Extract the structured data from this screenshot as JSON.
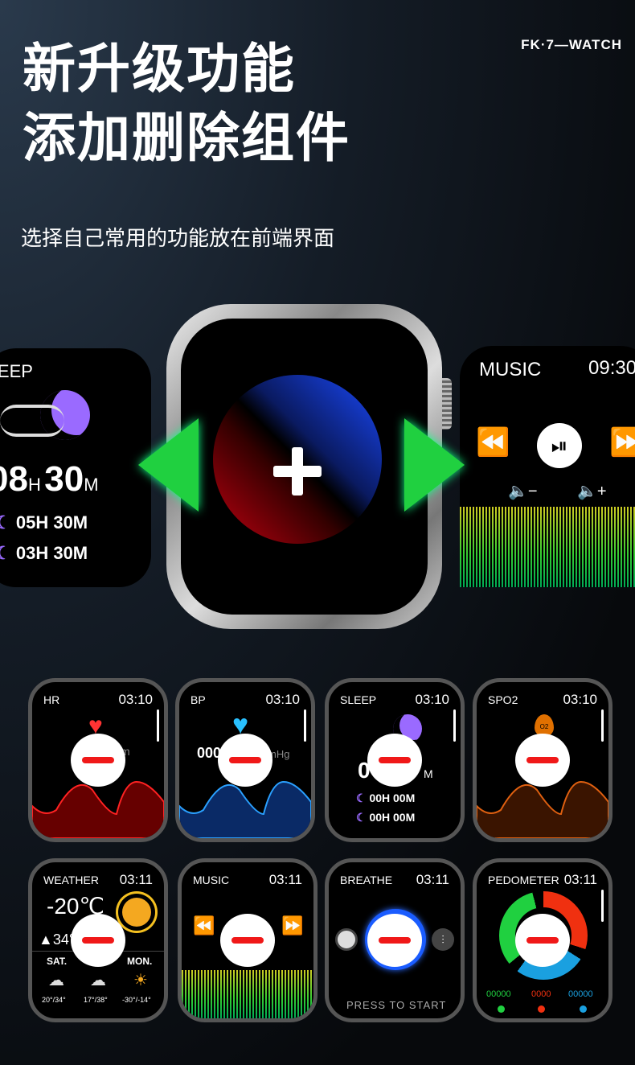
{
  "brand": "FK·7—WATCH",
  "headline": [
    "新升级功能",
    "添加删除组件"
  ],
  "subtitle": "选择自己常用的功能放在前端界面",
  "left_card": {
    "label": "SLEEP",
    "total_h": "08",
    "total_m": "30",
    "h_unit": "H",
    "m_unit": "M",
    "deep": "05H 30M",
    "light": "03H 30M"
  },
  "right_card": {
    "label": "MUSIC",
    "time": "09:30"
  },
  "colors": {
    "accent_green": "#20d040",
    "minus_red": "#f01818"
  },
  "tiles": [
    {
      "label": "HR",
      "time": "03:10",
      "unit": "m"
    },
    {
      "label": "BP",
      "time": "03:10",
      "value": "000",
      "unit": "mHg"
    },
    {
      "label": "SLEEP",
      "time": "03:10",
      "value": "0",
      "unit": "M",
      "deep": "00H 00M",
      "light": "00H 00M"
    },
    {
      "label": "SPO2",
      "time": "03:10",
      "icon_text": "O2"
    },
    {
      "label": "WEATHER",
      "time": "03:11",
      "temp": "-20℃",
      "high": "34°",
      "days": [
        "SAT.",
        "MON."
      ],
      "ranges": [
        "20°/34°",
        "17°/38°",
        "-30°/-14°"
      ]
    },
    {
      "label": "MUSIC",
      "time": "03:11"
    },
    {
      "label": "BREATHE",
      "time": "03:11",
      "action": "PRESS TO START"
    },
    {
      "label": "PEDOMETER",
      "time": "03:11",
      "stats": [
        "00000",
        "0000",
        "00000"
      ]
    }
  ]
}
